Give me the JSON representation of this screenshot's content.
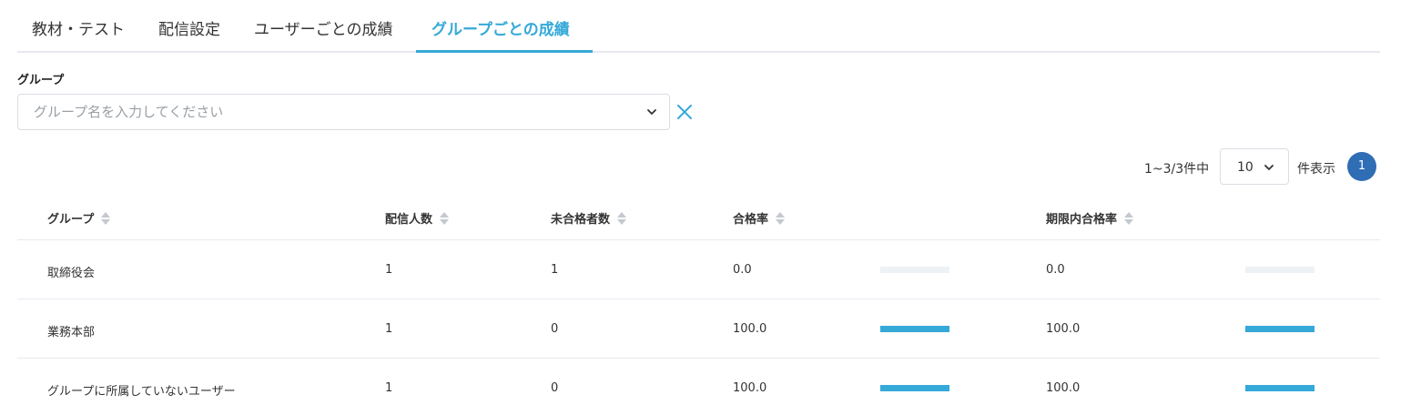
{
  "tabs": [
    {
      "label": "教材・テスト",
      "active": false
    },
    {
      "label": "配信設定",
      "active": false
    },
    {
      "label": "ユーザーごとの成績",
      "active": false
    },
    {
      "label": "グループごとの成績",
      "active": true
    }
  ],
  "filter": {
    "label": "グループ",
    "placeholder": "グループ名を入力してください",
    "value": ""
  },
  "pagination": {
    "range_text": "1~3/3件中",
    "per_page": "10",
    "per_page_suffix": "件表示",
    "current_page": "1"
  },
  "table": {
    "headers": {
      "group": "グループ",
      "delivered": "配信人数",
      "failed": "未合格者数",
      "pass_rate": "合格率",
      "deadline_pass_rate": "期限内合格率"
    },
    "rows": [
      {
        "group": "取締役会",
        "delivered": "1",
        "failed": "1",
        "pass_rate": "0.0",
        "pass_rate_value": 0.0,
        "deadline_pass_rate": "0.0",
        "deadline_pass_rate_value": 0.0
      },
      {
        "group": "業務本部",
        "delivered": "1",
        "failed": "0",
        "pass_rate": "100.0",
        "pass_rate_value": 100.0,
        "deadline_pass_rate": "100.0",
        "deadline_pass_rate_value": 100.0
      },
      {
        "group": "グループに所属していないユーザー",
        "delivered": "1",
        "failed": "0",
        "pass_rate": "100.0",
        "pass_rate_value": 100.0,
        "deadline_pass_rate": "100.0",
        "deadline_pass_rate_value": 100.0
      }
    ]
  },
  "icons": {
    "select_chevron": "chevron-down-icon",
    "clear": "close-icon",
    "sort": "sort-icon"
  },
  "colors": {
    "accent": "#35a9d8",
    "page_button": "#2f6db5",
    "bar_track": "#eef1f5"
  }
}
